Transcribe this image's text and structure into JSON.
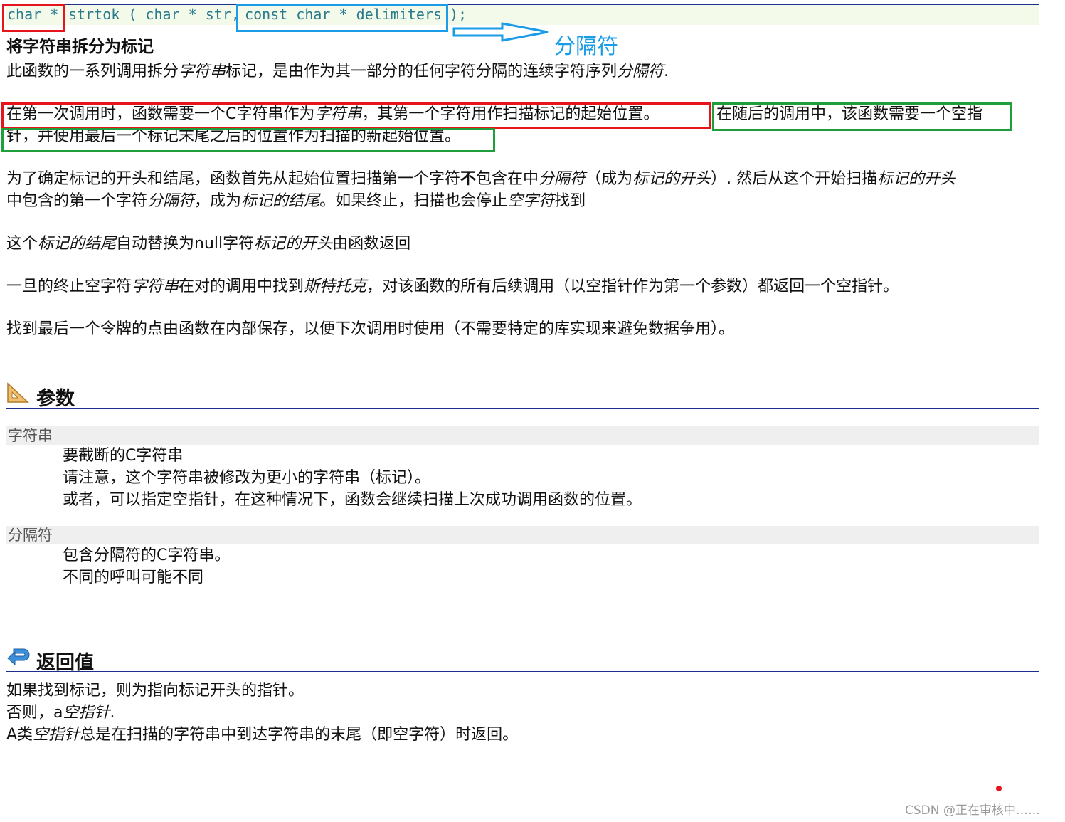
{
  "signature": {
    "return_type": "char *",
    "func_and_param1": " strtok ( char * str,",
    "param2": " const char * delimiters ",
    "end": ");"
  },
  "annotation": {
    "label": "分隔符"
  },
  "heading": "将字符串拆分为标记",
  "intro": [
    "此函数的一系列调用拆分",
    "字符串",
    "标记，是由作为其一部分的任何字符分隔的连续字符序列",
    "分隔符",
    "."
  ],
  "para_first_call": [
    "在第一次调用时，函数需要一个C字符串作为",
    "字符串",
    "，其第一个字符用作扫描标记的起始位置。"
  ],
  "para_subsequent_1": "在随后的调用中，该函数需要一个空指",
  "para_subsequent_2": "针，并使用最后一个标记末尾之后的位置作为扫描的新起始位置。",
  "para_scan_1": [
    "为了确定标记的开头和结尾，函数首先从起始位置扫描第一个字符",
    "不",
    "包含在中",
    "分隔符",
    "（成为",
    "标记的开头",
    "）. 然后从这个开始扫描",
    "标记的开头"
  ],
  "para_scan_2": [
    "中包含的第一个字符",
    "分隔符",
    "，成为",
    "标记的结尾",
    "。如果终止，扫描也会停止",
    "空字符",
    "找到"
  ],
  "para_replace": [
    "这个",
    "标记的结尾",
    "自动替换为null字符",
    "标记的开头",
    "由函数返回"
  ],
  "para_null": [
    "一旦的终止空字符",
    "字符串",
    "在对的调用中找到",
    "斯特托克",
    "，对该函数的所有后续调用（以空指针作为第一个参数）都返回一个空指针。"
  ],
  "para_save": "找到最后一个令牌的点由函数在内部保存，以便下次调用时使用（不需要特定的库实现来避免数据争用）。",
  "params": {
    "title": "参数",
    "items": [
      {
        "name": "字符串",
        "lines": [
          "要截断的C字符串",
          "请注意，这个字符串被修改为更小的字符串（标记）。",
          "或者，可以指定空指针，在这种情况下，函数会继续扫描上次成功调用函数的位置。"
        ]
      },
      {
        "name": "分隔符",
        "lines": [
          "包含分隔符的C字符串。",
          "不同的呼叫可能不同"
        ]
      }
    ]
  },
  "return_value": {
    "title": "返回值",
    "line1": "如果找到标记，则为指向标记开头的指针。",
    "line2": [
      "否则，a",
      "空指针",
      "."
    ],
    "line3": [
      "A类",
      "空指针",
      "总是在扫描的字符串中到达字符串的末尾（即空字符）时返回。"
    ]
  },
  "watermark": "CSDN @正在审核中……",
  "colors": {
    "red": "#e8141c",
    "blue": "#1a9de6",
    "green": "#1f9e3b",
    "rule": "#1c2f8c"
  }
}
